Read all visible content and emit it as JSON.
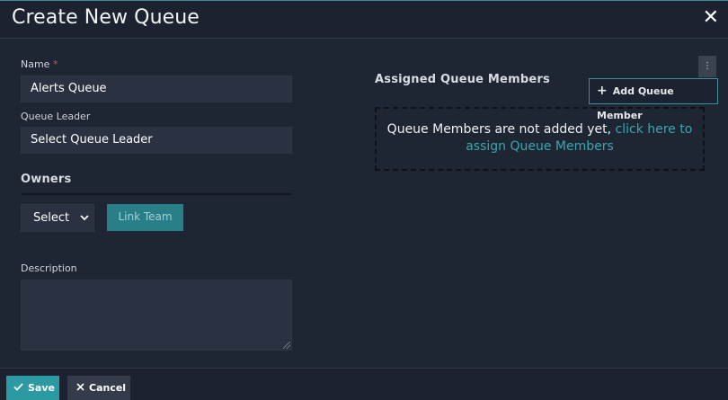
{
  "modal": {
    "title": "Create New Queue",
    "close_glyph": "✕"
  },
  "form": {
    "name_label": "Name",
    "required_mark": "*",
    "name_value": "Alerts Queue",
    "leader_label": "Queue Leader",
    "leader_value": "Select Queue Leader",
    "owners_title": "Owners",
    "owners_select_value": "Select",
    "link_team_label": "Link Team",
    "description_label": "Description",
    "description_value": ""
  },
  "members": {
    "title": "Assigned Queue Members",
    "add_button_label": "Add Queue Member",
    "empty_text": "Queue Members are not added yet,",
    "empty_link_line1": "click here to",
    "empty_link_line2": "assign Queue Members",
    "kebab_glyph": "⋮"
  },
  "footer": {
    "save_label": "Save",
    "cancel_label": "Cancel"
  },
  "icons": {
    "close": "close-icon",
    "plus": "plus-icon",
    "check": "check-icon",
    "cancel": "x-icon",
    "kebab": "kebab-menu-icon",
    "chevron": "chevron-down-icon"
  },
  "colors": {
    "accent": "#2c9aa3",
    "link": "#3aa6ae",
    "background": "#1e2533",
    "required": "#d9534f"
  }
}
